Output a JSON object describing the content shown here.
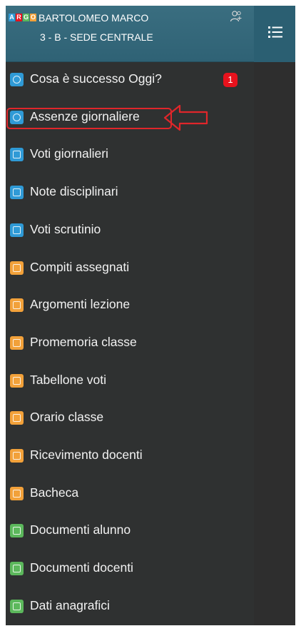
{
  "header": {
    "logo": [
      "A",
      "R",
      "G",
      "O"
    ],
    "student_name": "BARTOLOMEO MARCO",
    "class_info": "3 - B - SEDE CENTRALE"
  },
  "menu": {
    "items": [
      {
        "label": "Cosa è successo Oggi?",
        "icon": "info-icon",
        "color": "#2f9ad6",
        "badge": "1"
      },
      {
        "label": "Assenze giornaliere",
        "icon": "absence-icon",
        "color": "#2f9ad6"
      },
      {
        "label": "Voti giornalieri",
        "icon": "grades-icon",
        "color": "#2f9ad6"
      },
      {
        "label": "Note disciplinari",
        "icon": "notes-icon",
        "color": "#2f9ad6"
      },
      {
        "label": "Voti scrutinio",
        "icon": "final-grades-icon",
        "color": "#2f9ad6"
      },
      {
        "label": "Compiti assegnati",
        "icon": "homework-icon",
        "color": "#f2a13a"
      },
      {
        "label": "Argomenti lezione",
        "icon": "lesson-topics-icon",
        "color": "#f2a13a"
      },
      {
        "label": "Promemoria classe",
        "icon": "reminder-icon",
        "color": "#f2a13a"
      },
      {
        "label": "Tabellone voti",
        "icon": "grade-board-icon",
        "color": "#f2a13a"
      },
      {
        "label": "Orario classe",
        "icon": "timetable-icon",
        "color": "#f2a13a"
      },
      {
        "label": "Ricevimento docenti",
        "icon": "teacher-meeting-icon",
        "color": "#f2a13a"
      },
      {
        "label": "Bacheca",
        "icon": "bulletin-board-icon",
        "color": "#f2a13a"
      },
      {
        "label": "Documenti alunno",
        "icon": "student-documents-icon",
        "color": "#5cb85c"
      },
      {
        "label": "Documenti docenti",
        "icon": "teacher-documents-icon",
        "color": "#5cb85c"
      },
      {
        "label": "Dati anagrafici",
        "icon": "personal-data-icon",
        "color": "#5cb85c"
      }
    ]
  },
  "colors": {
    "header_bg": "#2f6275",
    "sidebar_bg": "#2f3131",
    "highlight": "#e0262a",
    "badge": "#e8121d"
  }
}
